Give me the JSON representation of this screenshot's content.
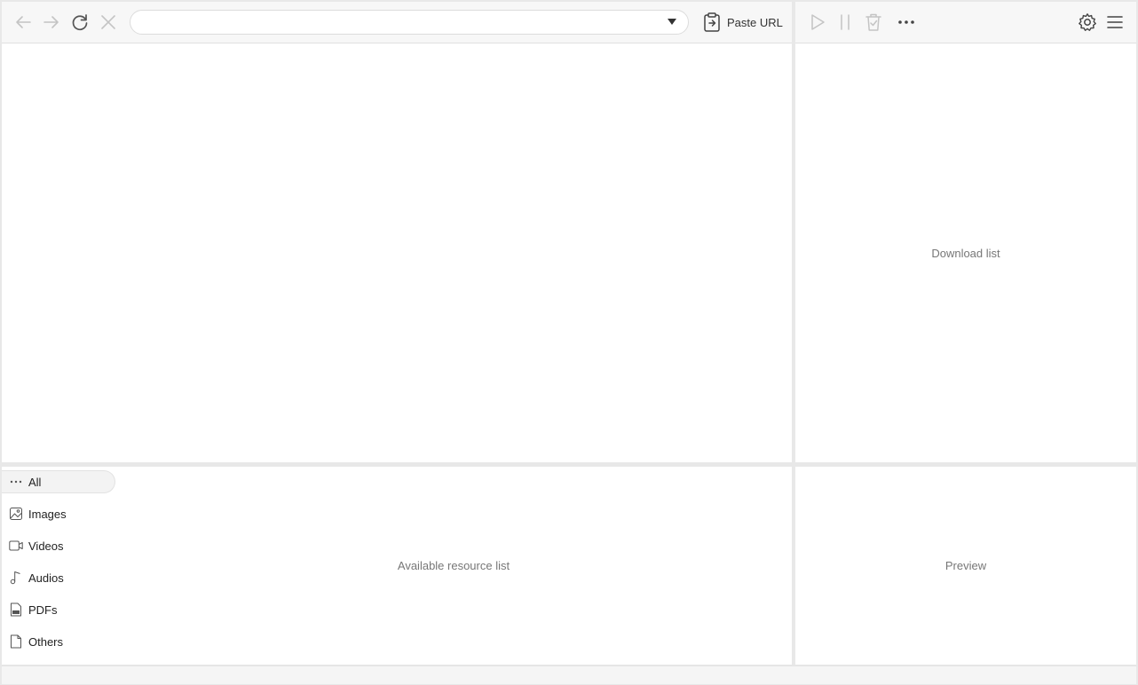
{
  "toolbar": {
    "url_value": "",
    "paste_label": "Paste URL"
  },
  "panels": {
    "download_placeholder": "Download list",
    "resource_placeholder": "Available resource list",
    "preview_placeholder": "Preview"
  },
  "categories": [
    {
      "label": "All",
      "icon": "more-dots-icon",
      "active": true
    },
    {
      "label": "Images",
      "icon": "image-icon",
      "active": false
    },
    {
      "label": "Videos",
      "icon": "video-icon",
      "active": false
    },
    {
      "label": "Audios",
      "icon": "music-note-icon",
      "active": false
    },
    {
      "label": "PDFs",
      "icon": "pdf-icon",
      "active": false
    },
    {
      "label": "Others",
      "icon": "file-icon",
      "active": false
    }
  ],
  "colors": {
    "disabled_icon": "#bdbdbd",
    "active_icon": "#555555",
    "panel_bg": "#ffffff",
    "toolbar_bg": "#f7f7f7"
  }
}
